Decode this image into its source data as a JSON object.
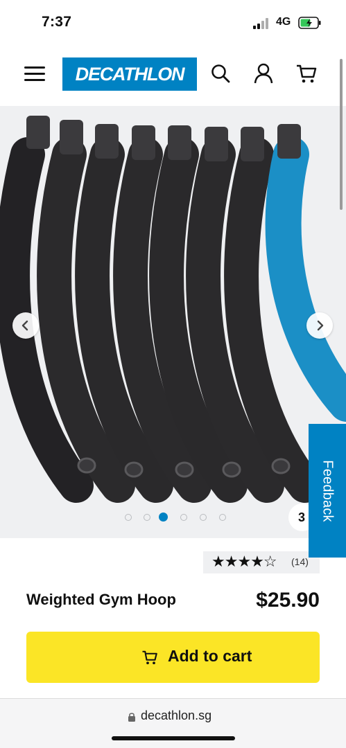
{
  "status_bar": {
    "time": "7:37",
    "network": "4G"
  },
  "header": {
    "logo_text": "DECATHLON",
    "icons": [
      "menu-icon",
      "search-icon",
      "account-icon",
      "cart-icon"
    ]
  },
  "gallery": {
    "total_images": 6,
    "active_index": 2,
    "view_3d_label": "3",
    "feedback_label": "Feedback",
    "product_color_main": "#2b2a2c",
    "product_color_accent": "#1b8fc6"
  },
  "rating": {
    "stars": "★★★★☆",
    "value": 4,
    "max": 5,
    "count": "(14)"
  },
  "product": {
    "title": "Weighted Gym Hoop",
    "price": "$25.90"
  },
  "cta": {
    "label": "Add to cart",
    "color": "#fbe526"
  },
  "browser": {
    "url": "decathlon.sg"
  },
  "colors": {
    "brand": "#0082c3",
    "cta": "#fbe526",
    "gallery_bg": "#eff0f2"
  }
}
